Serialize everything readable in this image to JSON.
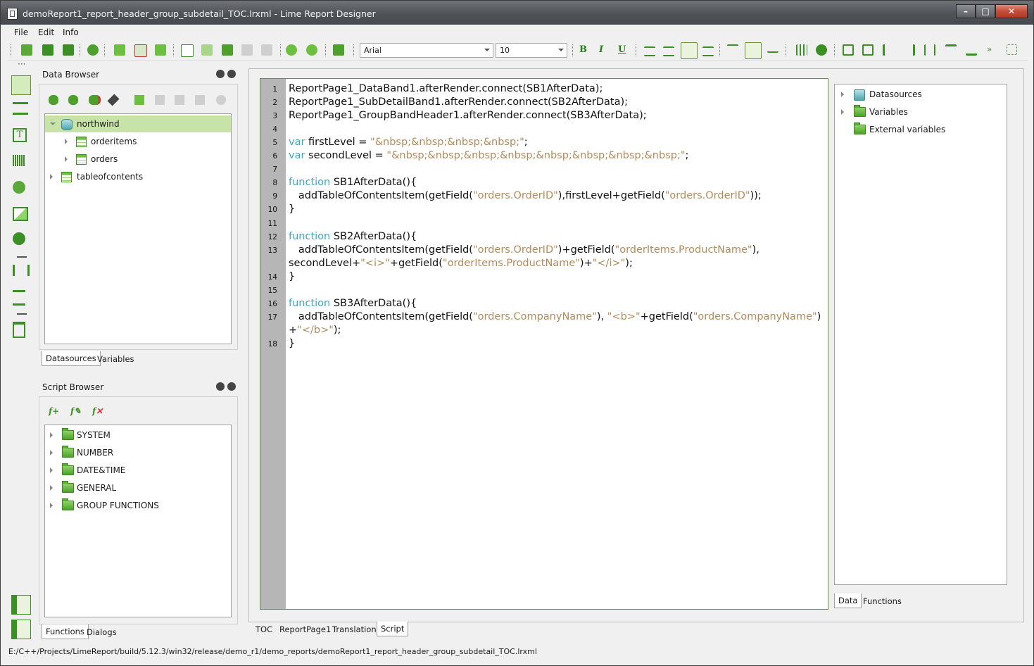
{
  "window": {
    "title": "demoReport1_report_header_group_subdetail_TOC.lrxml - Lime Report Designer",
    "controls": [
      "minimize",
      "maximize",
      "close"
    ]
  },
  "menu": [
    "File",
    "Edit",
    "Info"
  ],
  "toolbar": {
    "font_name": "Arial",
    "font_size": "10",
    "bold_label": "B",
    "italic_label": "I",
    "underline_label": "U"
  },
  "data_browser": {
    "title": "Data Browser",
    "tree": [
      {
        "label": "northwind",
        "children": [
          "orderitems",
          "orders"
        ]
      },
      {
        "label": "tableofcontents"
      }
    ],
    "tabs": [
      "Datasources",
      "Variables"
    ]
  },
  "script_browser": {
    "title": "Script Browser",
    "tree": [
      "SYSTEM",
      "NUMBER",
      "DATE&TIME",
      "GENERAL",
      "GROUP FUNCTIONS"
    ],
    "tabs": [
      "Functions",
      "Dialogs"
    ]
  },
  "editor": {
    "lines": [
      {
        "num": "1",
        "text": "ReportPage1_DataBand1.afterRender.connect(SB1AfterData);"
      },
      {
        "num": "2",
        "text": "ReportPage1_SubDetailBand1.afterRender.connect(SB2AfterData);"
      },
      {
        "num": "3",
        "text": "ReportPage1_GroupBandHeader1.afterRender.connect(SB3AfterData);"
      },
      {
        "num": "4",
        "text": ""
      },
      {
        "num": "5",
        "kw": "var",
        "text": " firstLevel = ",
        "str": "\"&nbsp;&nbsp;&nbsp;&nbsp;\"",
        "tail": ";"
      },
      {
        "num": "6",
        "kw": "var",
        "text": " secondLevel = ",
        "str": "\"&nbsp;&nbsp;&nbsp;&nbsp;&nbsp;&nbsp;&nbsp;&nbsp;\"",
        "tail": ";"
      },
      {
        "num": "7",
        "text": ""
      },
      {
        "num": "8",
        "kw": "function",
        "text": " SB1AfterData(){"
      },
      {
        "num": "9",
        "segments": [
          "   addTableOfContentsItem(getField(",
          "\"orders.OrderID\"",
          "),firstLevel+getField(",
          "\"orders.OrderID\"",
          "));"
        ]
      },
      {
        "num": "10",
        "text": "}"
      },
      {
        "num": "11",
        "text": ""
      },
      {
        "num": "12",
        "kw": "function",
        "text": " SB2AfterData(){"
      },
      {
        "num": "13",
        "segments": [
          "   addTableOfContentsItem(getField(",
          "\"orders.OrderID\"",
          ")+getField(",
          "\"orderItems.ProductName\"",
          "),"
        ]
      },
      {
        "num": "",
        "segments": [
          "secondLevel+",
          "\"<i>\"",
          "+getField(",
          "\"orderItems.ProductName\"",
          ")+",
          "\"</i>\"",
          ");"
        ]
      },
      {
        "num": "14",
        "text": "}"
      },
      {
        "num": "15",
        "text": ""
      },
      {
        "num": "16",
        "kw": "function",
        "text": " SB3AfterData(){"
      },
      {
        "num": "17",
        "segments": [
          "   addTableOfContentsItem(getField(",
          "\"orders.CompanyName\"",
          "), ",
          "\"<b>\"",
          "+getField(",
          "\"orders.CompanyName\"",
          ")"
        ]
      },
      {
        "num": "",
        "segments": [
          "+",
          "\"</b>\"",
          ");"
        ]
      },
      {
        "num": "18",
        "text": "}"
      }
    ]
  },
  "right_panel": {
    "tree": [
      "Datasources",
      "Variables",
      "External variables"
    ],
    "tabs": [
      "Data",
      "Functions"
    ]
  },
  "page_tabs": [
    "TOC",
    "ReportPage1",
    "Translations",
    "Script"
  ],
  "active_page_tab": "Script",
  "status": "E:/C++/Projects/LimeReport/build/5.12.3/win32/release/demo_r1/demo_reports/demoReport1_report_header_group_subdetail_TOC.lrxml",
  "colors": {
    "accent": "#c7e3a8",
    "keyword": "#3aa7c9",
    "string": "#b58a5a"
  }
}
